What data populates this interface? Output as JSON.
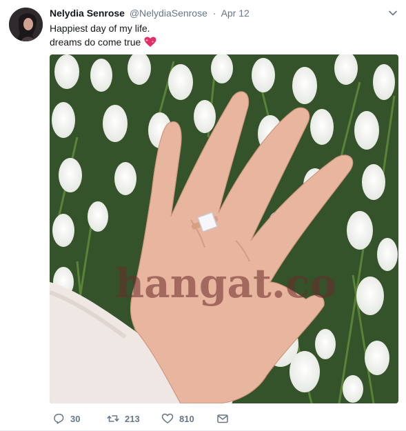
{
  "tweet": {
    "display_name": "Nelydia Senrose",
    "handle": "@NelydiaSenrose",
    "separator": "·",
    "date": "Apr 12",
    "text_lines": [
      "Happiest day of my life.",
      "dreams do come true"
    ],
    "emoji": "sparkling-heart-icon",
    "media": {
      "description_icon": "photo",
      "watermark": "hangat.co"
    },
    "actions": {
      "replies": "30",
      "retweets": "213",
      "likes": "810"
    }
  },
  "colors": {
    "text": "#14171a",
    "secondary": "#657786",
    "emoji": "#e0306a"
  }
}
